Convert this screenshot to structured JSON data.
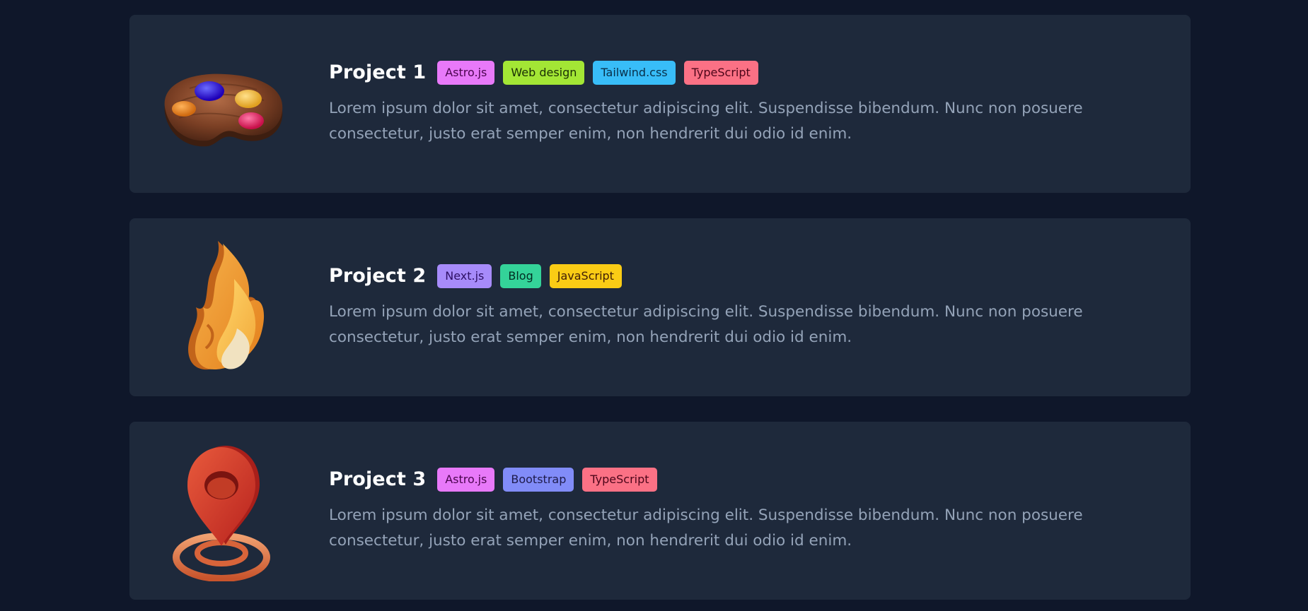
{
  "projects": [
    {
      "title": "Project 1",
      "icon": "palette-icon",
      "tags": [
        {
          "label": "Astro.js",
          "bg": "#e879f9",
          "fg": "#4a044e"
        },
        {
          "label": "Web design",
          "bg": "#a3e635",
          "fg": "#1a2e05"
        },
        {
          "label": "Tailwind.css",
          "bg": "#38bdf8",
          "fg": "#082f49"
        },
        {
          "label": "TypeScript",
          "bg": "#fb7185",
          "fg": "#4c0519"
        }
      ],
      "description": "Lorem ipsum dolor sit amet, consectetur adipiscing elit. Suspendisse bibendum. Nunc non posuere consectetur, justo erat semper enim, non hendrerit dui odio id enim."
    },
    {
      "title": "Project 2",
      "icon": "fire-icon",
      "tags": [
        {
          "label": "Next.js",
          "bg": "#a78bfa",
          "fg": "#2e1065"
        },
        {
          "label": "Blog",
          "bg": "#34d399",
          "fg": "#022c22"
        },
        {
          "label": "JavaScript",
          "bg": "#facc15",
          "fg": "#422006"
        }
      ],
      "description": "Lorem ipsum dolor sit amet, consectetur adipiscing elit. Suspendisse bibendum. Nunc non posuere consectetur, justo erat semper enim, non hendrerit dui odio id enim."
    },
    {
      "title": "Project 3",
      "icon": "location-pin-icon",
      "tags": [
        {
          "label": "Astro.js",
          "bg": "#e879f9",
          "fg": "#4a044e"
        },
        {
          "label": "Bootstrap",
          "bg": "#818cf8",
          "fg": "#1e1b4b"
        },
        {
          "label": "TypeScript",
          "bg": "#fb7185",
          "fg": "#4c0519"
        }
      ],
      "description": "Lorem ipsum dolor sit amet, consectetur adipiscing elit. Suspendisse bibendum. Nunc non posuere consectetur, justo erat semper enim, non hendrerit dui odio id enim."
    }
  ]
}
